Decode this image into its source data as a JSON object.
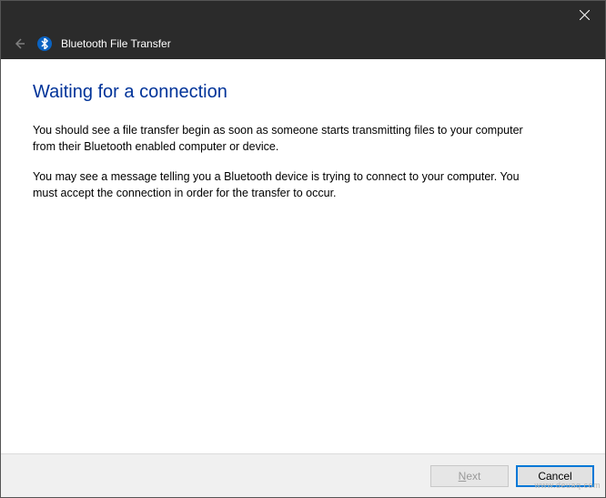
{
  "titlebar": {
    "close_tooltip": "Close"
  },
  "header": {
    "title": "Bluetooth File Transfer"
  },
  "content": {
    "heading": "Waiting for a connection",
    "para1": "You should see a file transfer begin as soon as someone starts transmitting files to your computer from their Bluetooth enabled computer or device.",
    "para2": "You may see a message telling you a Bluetooth device is trying to connect to your computer. You must accept the connection in order for the transfer to occur."
  },
  "footer": {
    "next_prefix": "N",
    "next_suffix": "ext",
    "cancel_label": "Cancel"
  },
  "watermark": "www.deuaq.com"
}
